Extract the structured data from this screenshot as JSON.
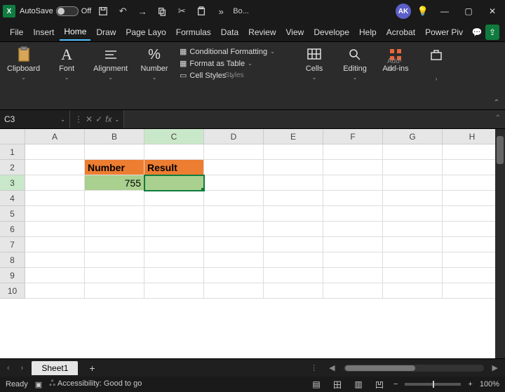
{
  "titlebar": {
    "autosave_label": "AutoSave",
    "autosave_state": "Off",
    "doc_title": "Bo...",
    "avatar": "AK"
  },
  "menu": {
    "tabs": [
      "File",
      "Insert",
      "Home",
      "Draw",
      "Page Layo",
      "Formulas",
      "Data",
      "Review",
      "View",
      "Develope",
      "Help",
      "Acrobat",
      "Power Piv"
    ],
    "active": 2
  },
  "ribbon": {
    "clipboard": "Clipboard",
    "font": "Font",
    "alignment": "Alignment",
    "number": "Number",
    "cond_fmt": "Conditional Formatting",
    "fmt_table": "Format as Table",
    "cell_styles": "Cell Styles",
    "styles_label": "Styles",
    "cells": "Cells",
    "editing": "Editing",
    "addins": "Add-ins",
    "addins_label": "Add-ins"
  },
  "fbar": {
    "namebox": "C3",
    "formula": ""
  },
  "grid": {
    "cols": [
      "A",
      "B",
      "C",
      "D",
      "E",
      "F",
      "G",
      "H"
    ],
    "rows": [
      "1",
      "2",
      "3",
      "4",
      "5",
      "6",
      "7",
      "8",
      "9",
      "10"
    ],
    "active_col": "C",
    "active_row": "3",
    "cells": {
      "B2": "Number",
      "C2": "Result",
      "B3": "755"
    }
  },
  "sheets": {
    "active": "Sheet1"
  },
  "status": {
    "ready": "Ready",
    "accessibility": "Accessibility: Good to go",
    "zoom": "100%"
  },
  "chart_data": {
    "type": "table",
    "headers": [
      "Number",
      "Result"
    ],
    "rows": [
      [
        755,
        null
      ]
    ]
  }
}
